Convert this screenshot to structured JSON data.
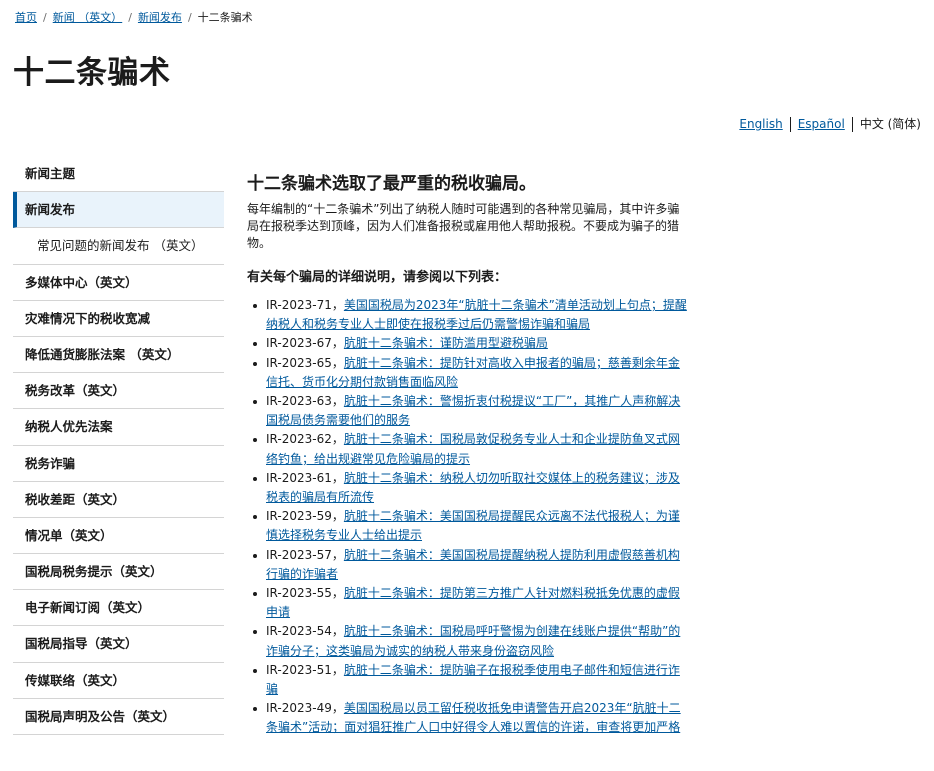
{
  "breadcrumb": {
    "items": [
      "首页",
      "新闻 （英文）",
      "新闻发布"
    ],
    "current": "十二条骗术"
  },
  "page_title": "十二条骗术",
  "languages": {
    "english": "English",
    "espanol": "Español",
    "chinese": "中文 (简体)"
  },
  "sidenav": {
    "header": "新闻主题",
    "items": [
      "新闻发布",
      "常见问题的新闻发布 （英文）",
      "多媒体中心（英文）",
      "灾难情况下的税收宽减",
      "降低通货膨胀法案 （英文）",
      "税务改革（英文）",
      "纳税人优先法案",
      "税务诈骗",
      "税收差距（英文）",
      "情况单（英文）",
      "国税局税务提示（英文）",
      "电子新闻订阅（英文）",
      "国税局指导（英文）",
      "传媒联络（英文）",
      "国税局声明及公告（英文）"
    ]
  },
  "main": {
    "heading": "十二条骗术选取了最严重的税收骗局。",
    "intro": "每年编制的“十二条骗术”列出了纳税人随时可能遇到的各种常见骗局，其中许多骗局在报税季达到顶峰，因为人们准备报税或雇用他人帮助报税。不要成为骗子的猎物。",
    "list_heading": "有关每个骗局的详细说明，请参阅以下列表：",
    "items": [
      {
        "ir": "IR-2023-71，",
        "link": "美国国税局为2023年“肮脏十二条骗术”清单活动划上句点；提醒纳税人和税务专业人士即使在报税季过后仍需警惕诈骗和骗局"
      },
      {
        "ir": "IR-2023-67，",
        "link": "肮脏十二条骗术：谨防滥用型避税骗局"
      },
      {
        "ir": "IR-2023-65，",
        "link": "肮脏十二条骗术：提防针对高收入申报者的骗局；慈善剩余年金信托、货币化分期付款销售面临风险"
      },
      {
        "ir": "IR-2023-63，",
        "link": "肮脏十二条骗术：警惕折衷付税提议“工厂”，其推广人声称解决国税局债务需要他们的服务"
      },
      {
        "ir": "IR-2023-62，",
        "link": "肮脏十二条骗术：国税局敦促税务专业人士和企业提防鱼叉式网络钓鱼；给出规避常见危险骗局的提示"
      },
      {
        "ir": "IR-2023-61，",
        "link": "肮脏十二条骗术：纳税人切勿听取社交媒体上的税务建议；涉及税表的骗局有所流传"
      },
      {
        "ir": "IR-2023-59，",
        "link": "肮脏十二条骗术：美国国税局提醒民众远离不法代报税人；为谨慎选择税务专业人士给出提示"
      },
      {
        "ir": "IR-2023-57，",
        "link": "肮脏十二条骗术：美国国税局提醒纳税人提防利用虚假慈善机构行骗的诈骗者"
      },
      {
        "ir": "IR-2023-55，",
        "link": "肮脏十二条骗术：提防第三方推广人针对燃料税抵免优惠的虚假申请"
      },
      {
        "ir": "IR-2023-54，",
        "link": "肮脏十二条骗术：国税局呼吁警惕为创建在线账户提供“帮助”的诈骗分子；这类骗局为诚实的纳税人带来身份盗窃风险"
      },
      {
        "ir": "IR-2023-51，",
        "link": "肮脏十二条骗术：提防骗子在报税季使用电子邮件和短信进行诈骗"
      },
      {
        "ir": "IR-2023-49，",
        "link": "美国国税局以员工留任税收抵免申请警告开启2023年“肮脏十二条骗术”活动；面对猖狂推广人口中好得令人难以置信的许诺，审查将更加严格"
      }
    ]
  }
}
